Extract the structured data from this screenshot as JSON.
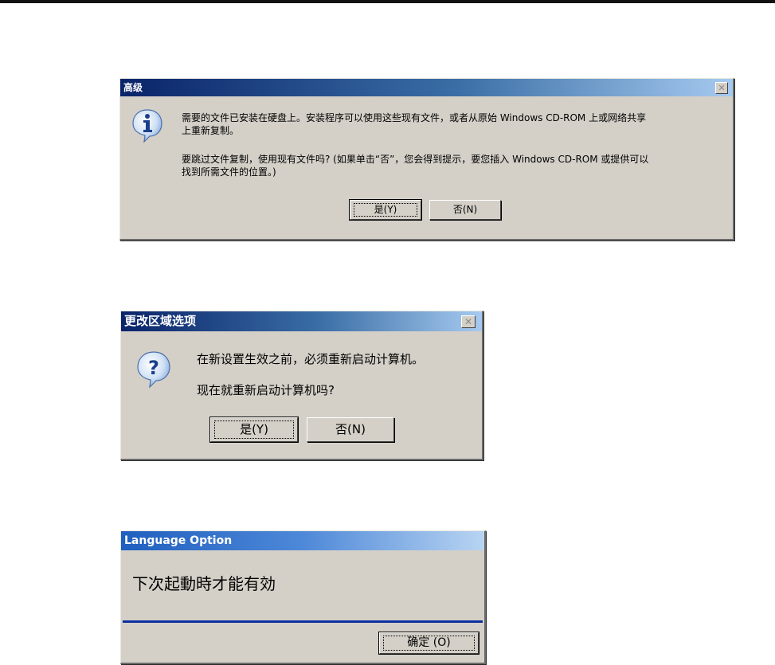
{
  "dialogs": {
    "advanced": {
      "title": "高级",
      "close_symbol": "✕",
      "message1_line1": "需要的文件已安装在硬盘上。安装程序可以使用这些现有文件，或者从原始 Windows CD-ROM 上或网络共享",
      "message1_line2": "上重新复制。",
      "message2_line1": "要跳过文件复制，使用现有文件吗? (如果单击“否”，您会得到提示，要您插入 Windows CD-ROM 或提供可以",
      "message2_line2": "找到所需文件的位置。)",
      "yes_label": "是(Y)",
      "no_label": "否(N)",
      "icon": "info-icon"
    },
    "region": {
      "title": "更改区域选项",
      "close_symbol": "✕",
      "message1": "在新设置生效之前，必须重新启动计算机。",
      "message2": "现在就重新启动计算机吗?",
      "yes_label": "是(Y)",
      "no_label": "否(N)",
      "icon": "question-icon"
    },
    "language": {
      "title": "Language Option",
      "message": "下次起動時才能有効",
      "ok_label": "确定 (O)"
    }
  },
  "colors": {
    "dialog_face": "#d4d0c8",
    "titlebar_start": "#0a246a",
    "titlebar_end": "#a6caf0",
    "separator": "#0b2fa0"
  }
}
